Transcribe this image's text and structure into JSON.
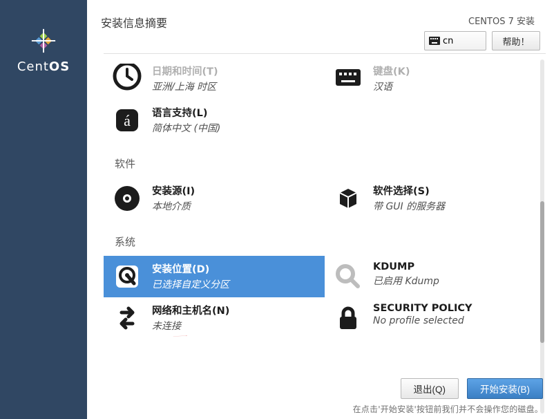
{
  "brand": "CentOS",
  "header": {
    "title": "安装信息摘要",
    "install_label": "CENTOS 7 安装",
    "keyboard_indicator": "cn",
    "help_button": "帮助！"
  },
  "sections": {
    "localization_partial": {
      "datetime": {
        "title": "日期和时间(T)",
        "sub": "亚洲/上海 时区"
      },
      "keyboard": {
        "title": "键盘(K)",
        "sub": "汉语"
      },
      "language": {
        "title": "语言支持(L)",
        "sub": "简体中文 (中国)"
      }
    },
    "software": {
      "label": "软件",
      "source": {
        "title": "安装源(I)",
        "sub": "本地介质"
      },
      "selection": {
        "title": "软件选择(S)",
        "sub": "带 GUI 的服务器"
      }
    },
    "system": {
      "label": "系统",
      "destination": {
        "title": "安装位置(D)",
        "sub": "已选择自定义分区"
      },
      "kdump": {
        "title": "KDUMP",
        "sub": "已启用 Kdump"
      },
      "network": {
        "title": "网络和主机名(N)",
        "sub": "未连接"
      },
      "security": {
        "title": "SECURITY POLICY",
        "sub": "No profile selected"
      }
    }
  },
  "footer": {
    "quit": "退出(Q)",
    "begin": "开始安装(B)",
    "hint": "在点击'开始安装'按钮前我们并不会操作您的磁盘。"
  }
}
